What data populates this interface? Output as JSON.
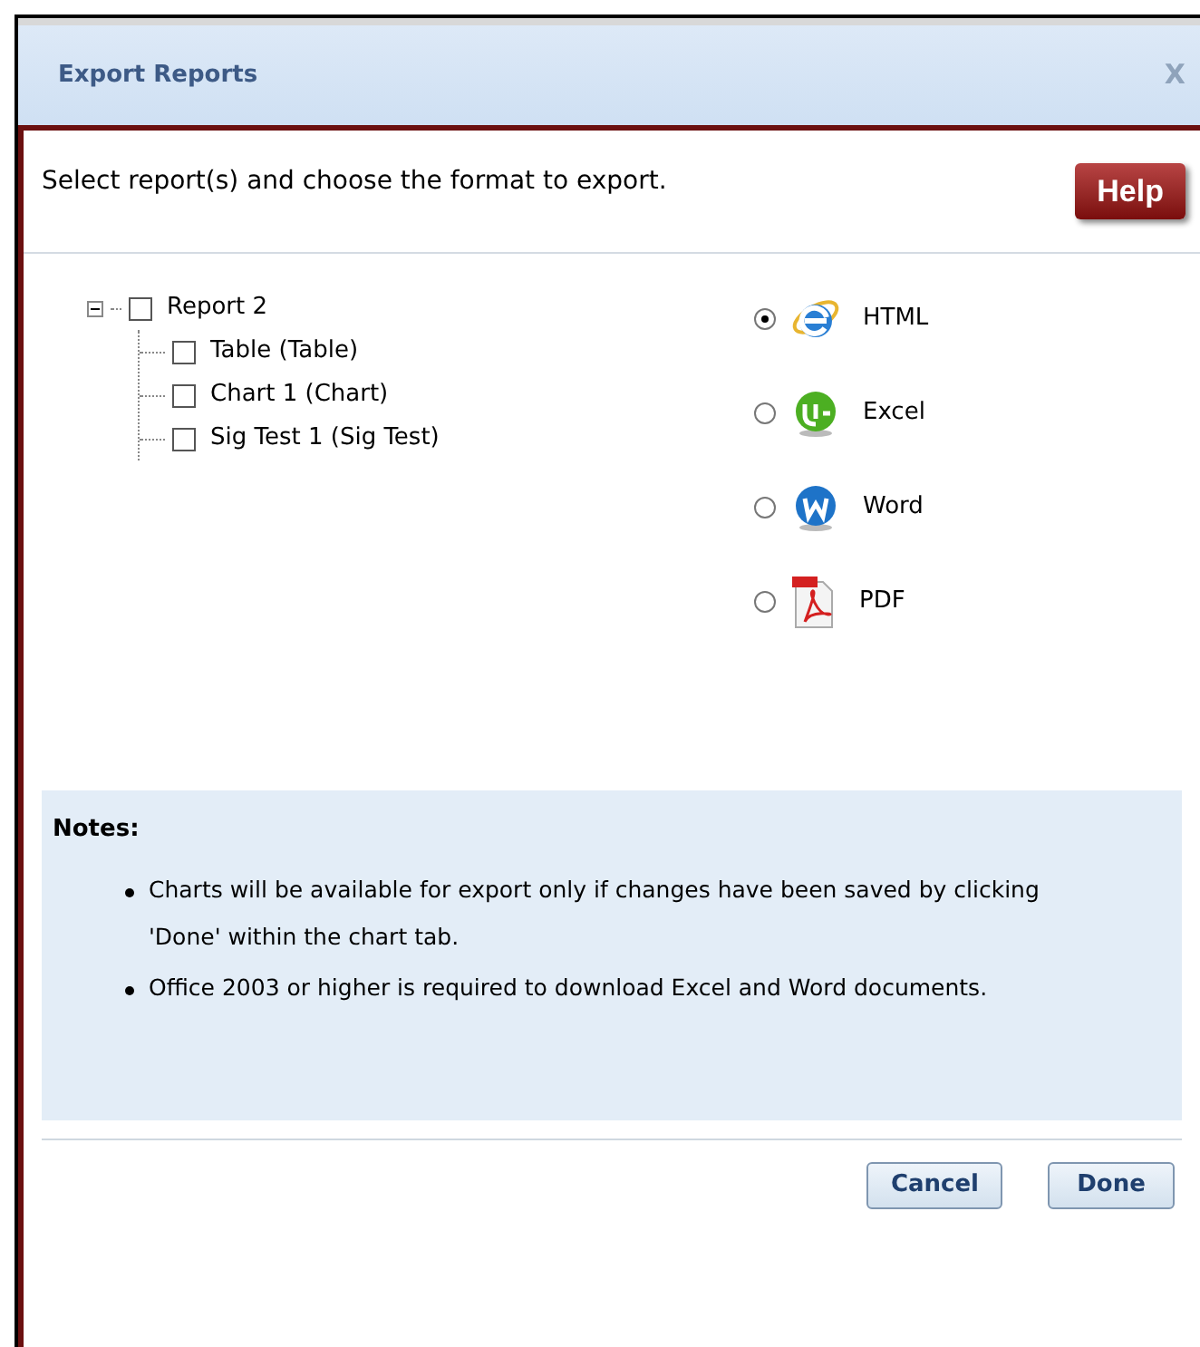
{
  "window": {
    "title": "Export Reports",
    "close": "X"
  },
  "instruction": "Select report(s) and choose the format to export.",
  "help_button": "Help",
  "tree": [
    {
      "label": "Report 2",
      "checked": false,
      "expanded": true,
      "children": [
        {
          "label": "Table (Table)",
          "checked": false
        },
        {
          "label": "Chart 1 (Chart)",
          "checked": false
        },
        {
          "label": "Sig Test 1 (Sig Test)",
          "checked": false
        }
      ]
    }
  ],
  "formats": [
    {
      "label": "HTML",
      "kind": "html",
      "selected": true
    },
    {
      "label": "Excel",
      "kind": "excel",
      "selected": false
    },
    {
      "label": "Word",
      "kind": "word",
      "selected": false
    },
    {
      "label": "PDF",
      "kind": "pdf",
      "selected": false
    }
  ],
  "notes": {
    "title": "Notes:",
    "items": [
      "Charts will be available for export only if changes have been saved by clicking 'Done' within the chart tab.",
      "Office 2003 or higher is required to download Excel and Word documents."
    ]
  },
  "buttons": [
    "Cancel",
    "Done"
  ]
}
